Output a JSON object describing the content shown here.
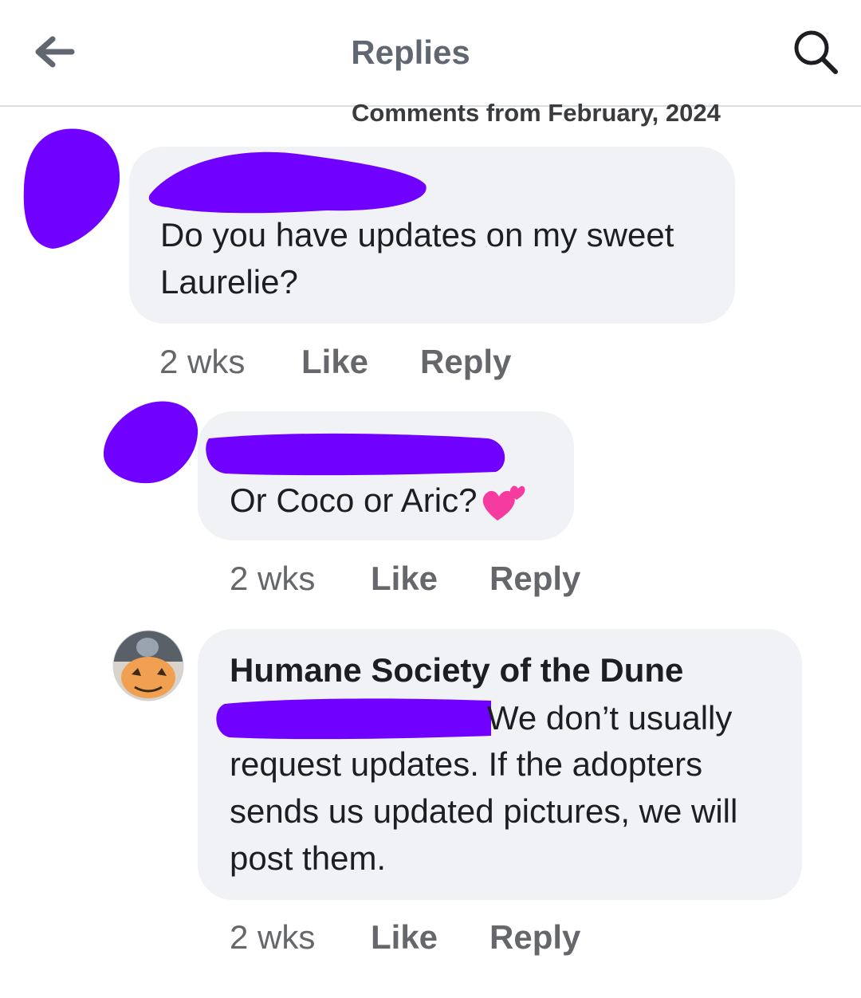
{
  "header": {
    "title": "Replies",
    "back_icon": "arrow-left-icon",
    "search_icon": "search-icon"
  },
  "subheader": {
    "text": "Comments from February, 2024"
  },
  "colors": {
    "redaction": "#7000ff",
    "bubble": "#f0f2f5",
    "meta_text": "#65676b"
  },
  "comments": [
    {
      "text": "Do you have updates on my sweet Laurelie?",
      "time": "2 wks",
      "like": "Like",
      "reply": "Reply"
    },
    {
      "text": "Or Coco or Aric?",
      "emoji": "two-hearts-icon",
      "time": "2 wks",
      "like": "Like",
      "reply": "Reply"
    },
    {
      "author": "Humane Society of the Dune",
      "text_line1": "We don’t usually",
      "text_rest": "request updates. If the adopters sends us updated pictures, we will post them.",
      "time": "2 wks",
      "like": "Like",
      "reply": "Reply"
    }
  ]
}
